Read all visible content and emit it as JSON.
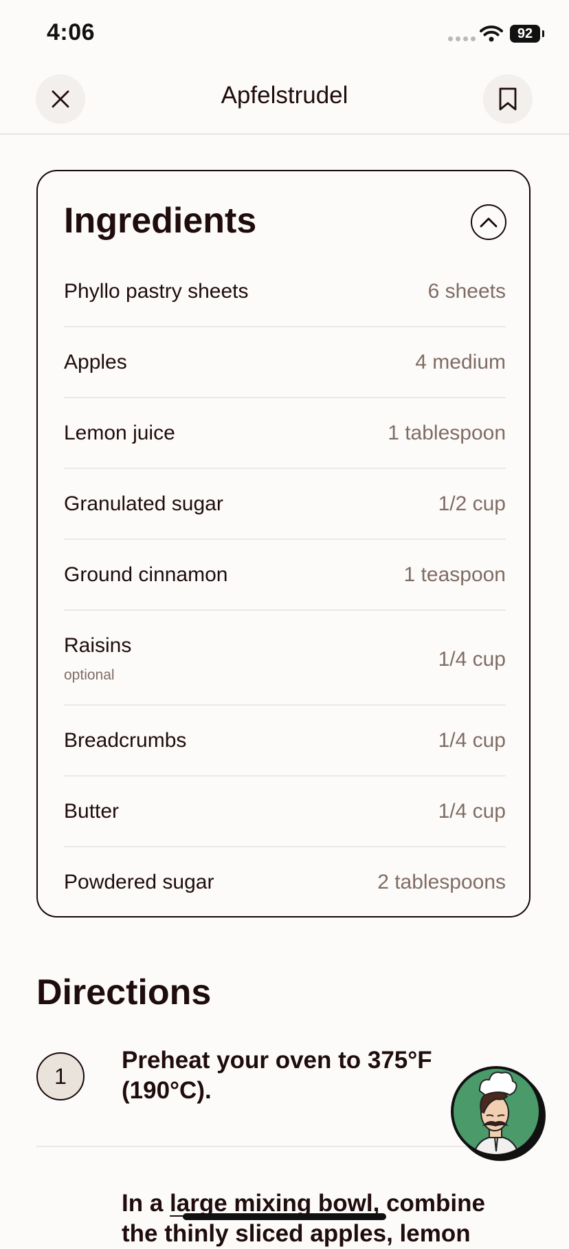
{
  "status_bar": {
    "time": "4:06",
    "battery": "92"
  },
  "nav": {
    "title": "Apfelstrudel"
  },
  "ingredients": {
    "title": "Ingredients",
    "items": [
      {
        "name": "Phyllo pastry sheets",
        "qty": "6 sheets"
      },
      {
        "name": "Apples",
        "qty": "4 medium"
      },
      {
        "name": "Lemon juice",
        "qty": "1 tablespoon"
      },
      {
        "name": "Granulated sugar",
        "qty": "1/2 cup"
      },
      {
        "name": "Ground cinnamon",
        "qty": "1 teaspoon"
      },
      {
        "name": "Raisins",
        "note": "optional",
        "qty": "1/4 cup"
      },
      {
        "name": "Breadcrumbs",
        "qty": "1/4 cup"
      },
      {
        "name": "Butter",
        "qty": "1/4 cup"
      },
      {
        "name": "Powdered sugar",
        "qty": "2 tablespoons"
      }
    ]
  },
  "directions": {
    "title": "Directions",
    "steps": [
      {
        "number": "1",
        "text": "Preheat your oven to 375°F (190°C)."
      },
      {
        "text_before": "In a ",
        "link": "large mixing bowl",
        "text_after": ", combine",
        "line2": "the thinly sliced apples, lemon"
      }
    ]
  },
  "icons": {
    "close": "close-icon",
    "bookmark": "bookmark-icon",
    "collapse": "chevron-up-icon",
    "chef": "chef-avatar-icon"
  },
  "colors": {
    "background": "#fcfbfa",
    "text": "#1f0c0c",
    "muted": "#7f6c63",
    "step_badge": "#e9e3db",
    "chef_green": "#4a9a6a"
  }
}
